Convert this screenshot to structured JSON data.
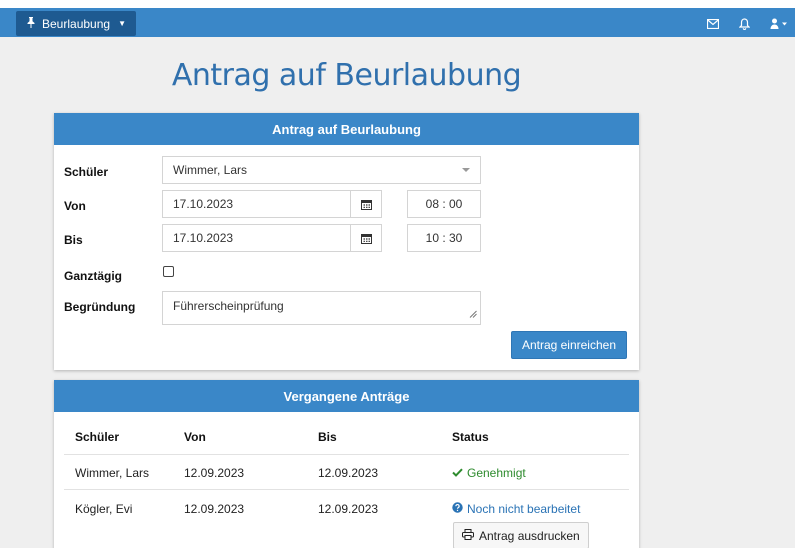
{
  "nav": {
    "menu_label": "Beurlaubung",
    "icons": [
      "pin-icon",
      "mail-icon",
      "bell-icon",
      "user-icon"
    ]
  },
  "page": {
    "title": "Antrag auf Beurlaubung"
  },
  "form": {
    "header": "Antrag auf Beurlaubung",
    "student_label": "Schüler",
    "student_value": "Wimmer, Lars",
    "from_label": "Von",
    "from_date": "17.10.2023",
    "from_time": "08 : 00",
    "to_label": "Bis",
    "to_date": "17.10.2023",
    "to_time": "10 : 30",
    "allday_label": "Ganztägig",
    "allday_checked": false,
    "reason_label": "Begründung",
    "reason_value": "Führerscheinprüfung",
    "submit_label": "Antrag einreichen"
  },
  "past": {
    "header": "Vergangene Anträge",
    "columns": [
      "Schüler",
      "Von",
      "Bis",
      "Status"
    ],
    "rows": [
      {
        "student": "Wimmer, Lars",
        "from": "12.09.2023",
        "to": "12.09.2023",
        "status": "Genehmigt"
      },
      {
        "student": "Kögler, Evi",
        "from": "12.09.2023",
        "to": "12.09.2023",
        "status": "Noch nicht bearbeitet",
        "action": "Antrag ausdrucken"
      }
    ]
  },
  "colors": {
    "primary": "#3a87c8",
    "nav_button": "#1e5a91",
    "approved": "#2e8b2e",
    "pending": "#2a73b5",
    "title": "#3070ad"
  }
}
